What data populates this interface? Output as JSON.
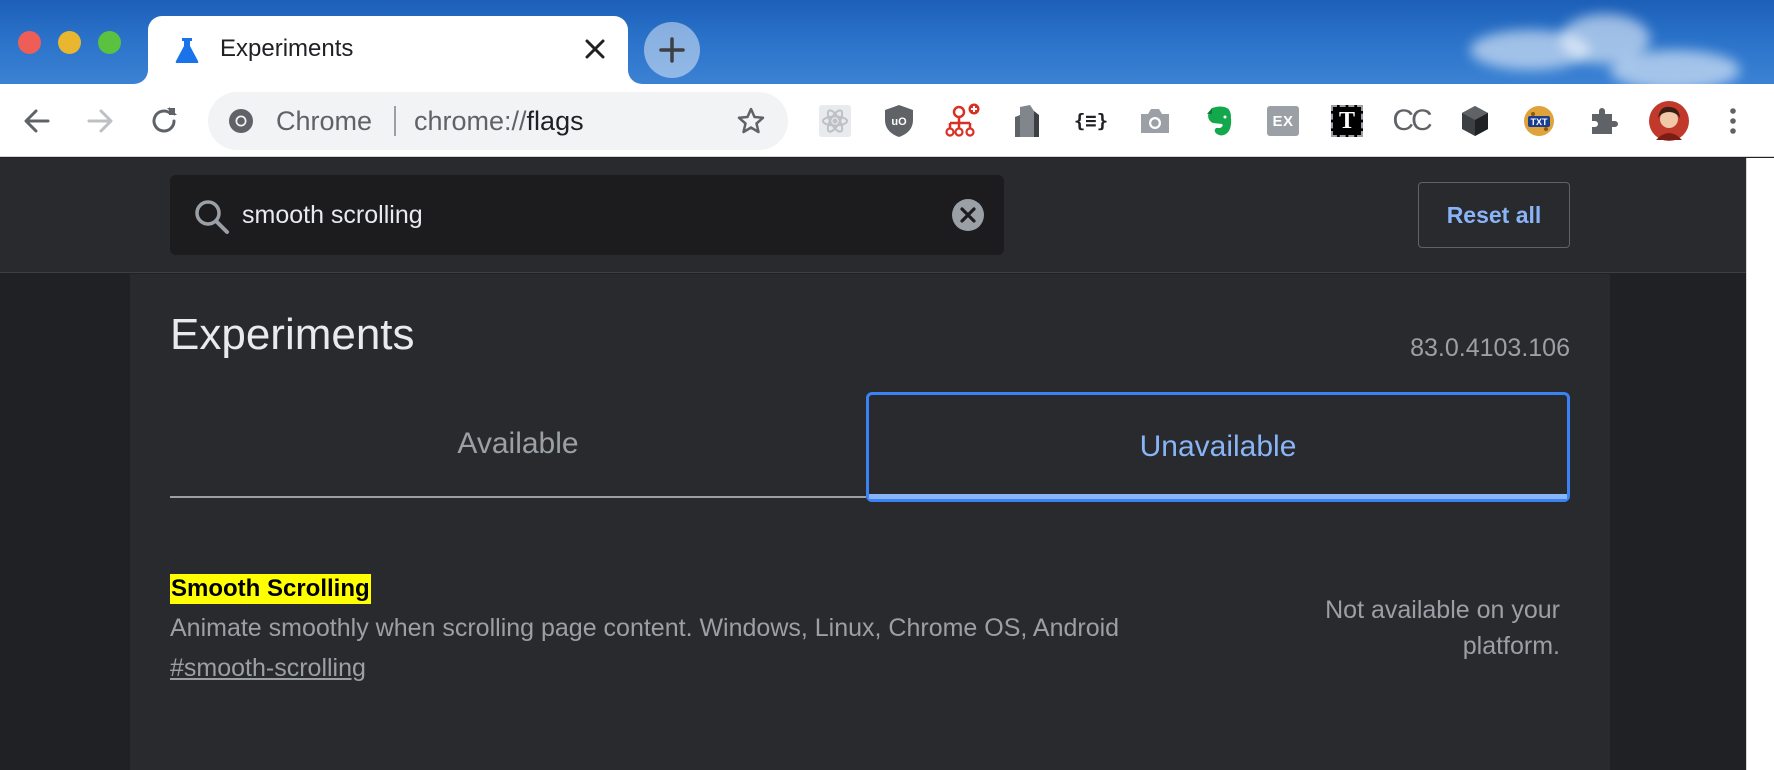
{
  "window": {
    "tab": {
      "title": "Experiments"
    }
  },
  "toolbar": {
    "site_label": "Chrome",
    "url_prefix": "chrome://",
    "url_host": "flags",
    "extensions": [
      "react-devtools-icon",
      "ublock-icon",
      "sitemap-icon",
      "tower-icon",
      "json-formatter-icon",
      "camera-icon",
      "evernote-icon",
      "ex-icon",
      "t-icon",
      "cc-icon",
      "cube-icon",
      "txt-icon",
      "puzzle-icon",
      "avatar",
      "menu-icon"
    ],
    "ex_label": "EX",
    "t_label": "T",
    "cc_label": "CC",
    "txt_label": "TXT",
    "json_label": "{≡}"
  },
  "search": {
    "value": "smooth scrolling"
  },
  "reset_label": "Reset all",
  "page": {
    "title": "Experiments",
    "version": "83.0.4103.106",
    "tabs": [
      {
        "label": "Available"
      },
      {
        "label": "Unavailable"
      }
    ]
  },
  "flag": {
    "name": "Smooth Scrolling",
    "description": "Animate smoothly when scrolling page content. Windows, Linux, Chrome OS, Android",
    "link": "#smooth-scrolling",
    "status_line1": "Not available on your",
    "status_line2": "platform."
  },
  "colors": {
    "accent": "#8ab4f8",
    "highlight": "#ffff00",
    "page_bg": "#292a2d"
  }
}
